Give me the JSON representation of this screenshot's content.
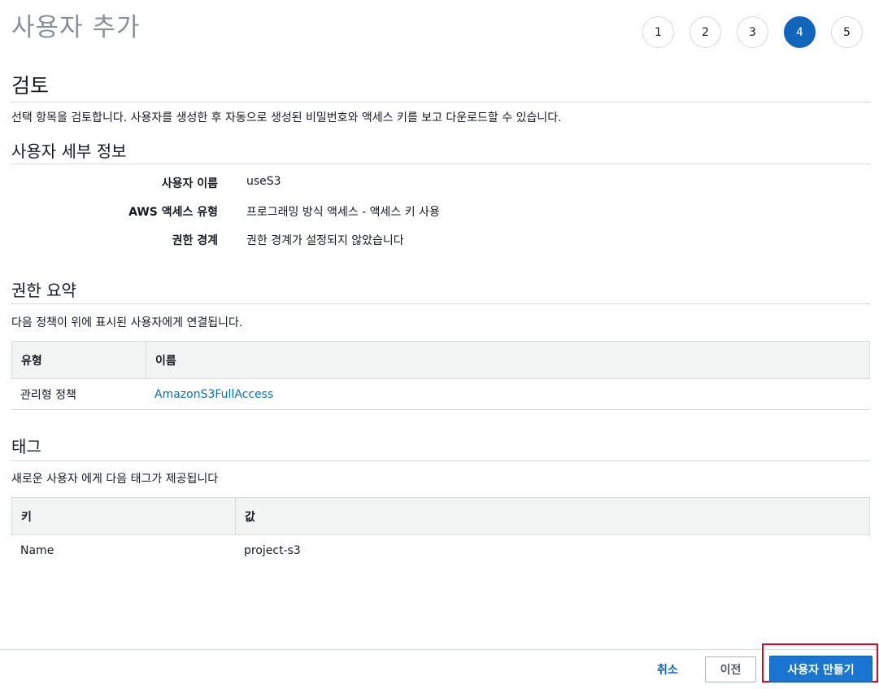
{
  "page_title": "사용자 추가",
  "steps": [
    {
      "label": "1",
      "active": false
    },
    {
      "label": "2",
      "active": false
    },
    {
      "label": "3",
      "active": false
    },
    {
      "label": "4",
      "active": true
    },
    {
      "label": "5",
      "active": false
    }
  ],
  "review": {
    "heading": "검토",
    "description": "선택 항목을 검토합니다. 사용자를 생성한 후 자동으로 생성된 비밀번호와 액세스 키를 보고 다운로드할 수 있습니다."
  },
  "user_details": {
    "heading": "사용자 세부 정보",
    "rows": [
      {
        "key": "사용자 이름",
        "value": "useS3"
      },
      {
        "key": "AWS 액세스 유형",
        "value": "프로그래밍 방식 액세스 - 액세스 키 사용"
      },
      {
        "key": "권한 경계",
        "value": "권한 경계가 설정되지 않았습니다"
      }
    ]
  },
  "permissions": {
    "heading": "권한 요약",
    "description": "다음 정책이 위에 표시된 사용자에게 연결됩니다.",
    "columns": [
      "유형",
      "이름"
    ],
    "rows": [
      {
        "type": "관리형 정책",
        "name": "AmazonS3FullAccess"
      }
    ]
  },
  "tags": {
    "heading": "태그",
    "description": "새로운 사용자 에게 다음 태그가 제공됩니다",
    "columns": [
      "키",
      "값"
    ],
    "rows": [
      {
        "key": "Name",
        "value": "project-s3"
      }
    ]
  },
  "footer": {
    "cancel_label": "취소",
    "previous_label": "이전",
    "create_label": "사용자 만들기"
  },
  "colors": {
    "primary": "#1a74d2",
    "active_step": "#1166bb",
    "link": "#0073bb",
    "highlight": "#e8001c"
  }
}
